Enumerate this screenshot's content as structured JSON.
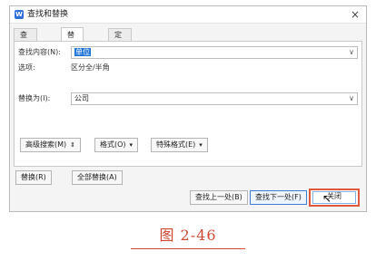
{
  "window": {
    "title": "查找和替换",
    "app_icon_letter": "W",
    "close_glyph": "×"
  },
  "tabs": [
    {
      "label": "查找(D)",
      "active": false
    },
    {
      "label": "替换(P)",
      "active": true
    },
    {
      "label": "定位(G)",
      "active": false
    }
  ],
  "find": {
    "label": "查找内容(N):",
    "value": "单位"
  },
  "options": {
    "label": "选项:",
    "value": "区分全/半角"
  },
  "replace": {
    "label": "替换为(I):",
    "value": "公司"
  },
  "search_buttons": {
    "advanced": "高级搜索(M)",
    "format": "格式(O)",
    "special": "特殊格式(E)"
  },
  "replace_buttons": {
    "replace": "替换(R)",
    "replace_all": "全部替换(A)"
  },
  "bottom_buttons": {
    "find_prev": "查找上一处(B)",
    "find_next": "查找下一处(F)",
    "close": "关闭"
  },
  "caption": "图 2-46",
  "colors": {
    "accent": "#1e73d6",
    "caption": "#d0462f",
    "highlight_border": "#e0573a"
  }
}
